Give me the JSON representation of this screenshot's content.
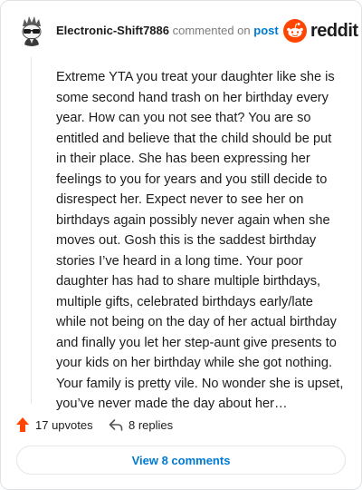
{
  "comment": {
    "username": "Electronic-Shift7886",
    "action_text": "commented on",
    "post_link": "post",
    "brand": "reddit",
    "body": "Extreme YTA you treat your daughter like she is some second hand trash on her birthday every year. How can you not see that? You are so entitled and believe that the child should be put in their place. She has been expressing her feelings to you for years and you still decide to disrespect her. Expect never to see her on birthdays again possibly never again when she moves out. Gosh this is the saddest birthday stories I’ve heard in a long time. Your poor daughter has had to share multiple birthdays, multiple gifts, celebrated birthdays early/late while not being on the day of her actual birthday and finally you let her step-aunt give presents to your kids on her birthday while she got nothing. Your family is pretty vile. No wonder she is upset, you’ve never made the day about her…"
  },
  "actions": {
    "upvotes": "17 upvotes",
    "replies": "8 replies"
  },
  "footer": {
    "view_comments": "View 8 comments"
  },
  "colors": {
    "accent_link": "#0079d3",
    "reddit_orange": "#ff4500",
    "text": "#1c1c1c",
    "muted": "#7c7c7c"
  },
  "icons": {
    "avatar": "snoo-avatar-with-sunglasses",
    "brand": "reddit-snoo-icon",
    "upvote": "upvote-arrow-icon",
    "reply": "reply-arrow-icon"
  }
}
